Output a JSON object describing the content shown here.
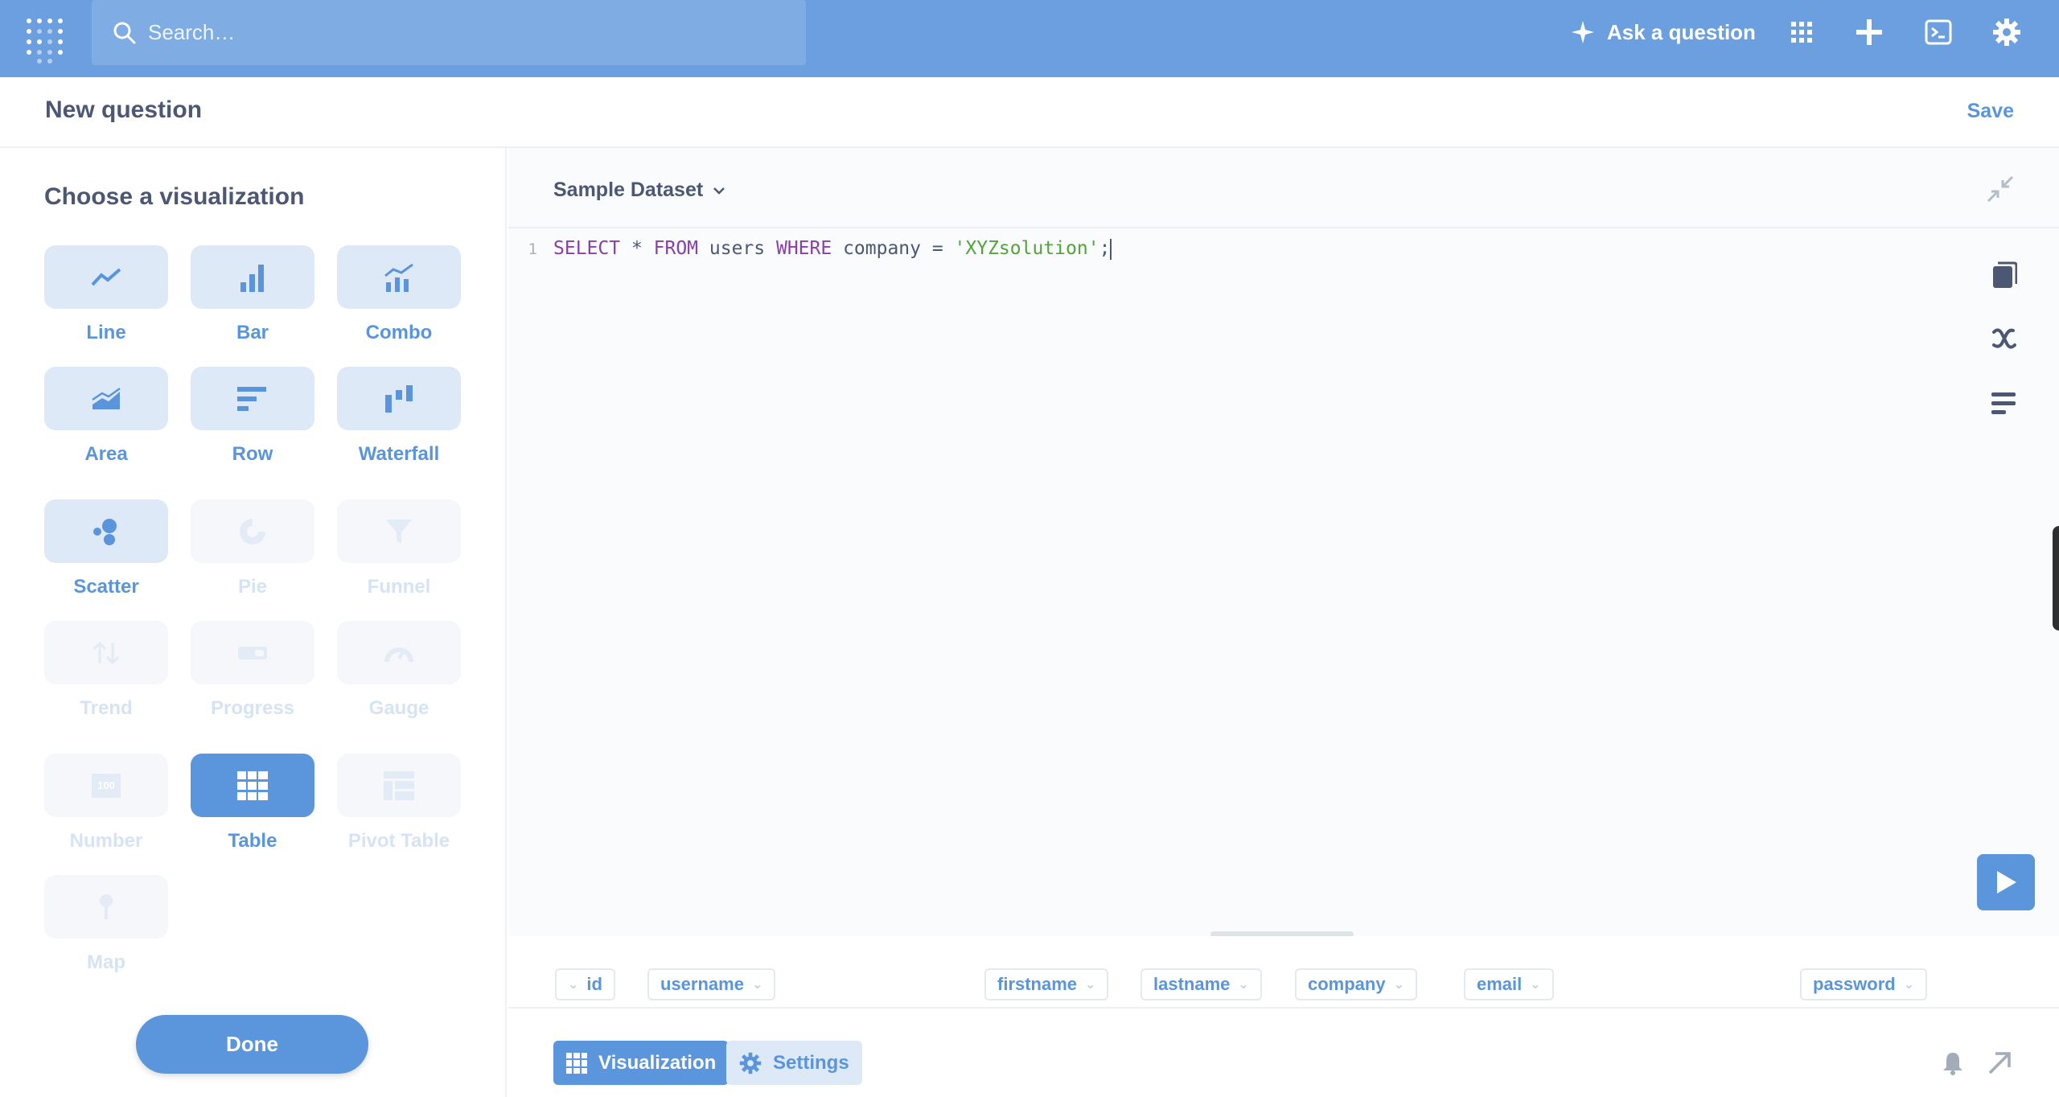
{
  "nav": {
    "search_placeholder": "Search…",
    "ask_label": "Ask a question",
    "icons": [
      "metabase-logo-icon",
      "search-icon",
      "sparkle-icon",
      "apps-grid-icon",
      "plus-icon",
      "terminal-icon",
      "gear-icon"
    ]
  },
  "header": {
    "title": "New question",
    "save_label": "Save"
  },
  "sidebar": {
    "heading": "Choose a visualization",
    "visualizations": [
      {
        "label": "Line",
        "state": "enabled",
        "icon": "line-chart-icon"
      },
      {
        "label": "Bar",
        "state": "enabled",
        "icon": "bar-chart-icon"
      },
      {
        "label": "Combo",
        "state": "enabled",
        "icon": "combo-chart-icon"
      },
      {
        "label": "Area",
        "state": "enabled",
        "icon": "area-chart-icon"
      },
      {
        "label": "Row",
        "state": "enabled",
        "icon": "row-chart-icon"
      },
      {
        "label": "Waterfall",
        "state": "enabled",
        "icon": "waterfall-chart-icon"
      },
      {
        "label": "Scatter",
        "state": "enabled",
        "icon": "scatter-chart-icon"
      },
      {
        "label": "Pie",
        "state": "disabled",
        "icon": "pie-chart-icon"
      },
      {
        "label": "Funnel",
        "state": "disabled",
        "icon": "funnel-icon"
      },
      {
        "label": "Trend",
        "state": "disabled",
        "icon": "trend-icon"
      },
      {
        "label": "Progress",
        "state": "disabled",
        "icon": "progress-icon"
      },
      {
        "label": "Gauge",
        "state": "disabled",
        "icon": "gauge-icon"
      },
      {
        "label": "Number",
        "state": "disabled",
        "icon": "number-icon"
      },
      {
        "label": "Table",
        "state": "selected",
        "icon": "table-icon"
      },
      {
        "label": "Pivot Table",
        "state": "disabled",
        "icon": "pivot-table-icon"
      },
      {
        "label": "Map",
        "state": "disabled",
        "icon": "map-pin-icon"
      }
    ],
    "number_icon_text": "100",
    "done_label": "Done"
  },
  "editor": {
    "database": "Sample Dataset",
    "line_number": "1",
    "sql": {
      "kw_select": "SELECT",
      "star": " * ",
      "kw_from": "FROM",
      "table": " users ",
      "kw_where": "WHERE",
      "condition": " company = ",
      "string": "'XYZsolution'",
      "end": ";"
    }
  },
  "results": {
    "columns": [
      "id",
      "username",
      "firstname",
      "lastname",
      "company",
      "email",
      "password"
    ]
  },
  "footer": {
    "visualization_label": "Visualization",
    "settings_label": "Settings"
  },
  "colors": {
    "brand": "#6b9fdf",
    "accent": "#5b96dc",
    "tile": "#dde9f7",
    "text": "#4c5773"
  }
}
